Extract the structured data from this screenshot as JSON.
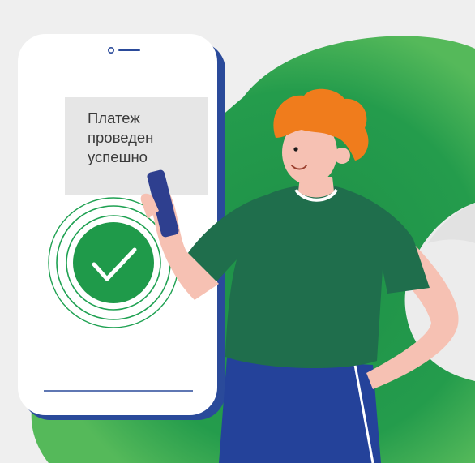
{
  "screen": {
    "message_lines": [
      "Платеж",
      "проведен",
      "успешно"
    ]
  },
  "colors": {
    "background": "#efefef",
    "brand_green": "#1f9a4a",
    "dark_green": "#1e6e4b",
    "phone_frame": "#2a4a9a",
    "hair": "#f07c1c",
    "skin": "#f6c1b3",
    "pants": "#24429a",
    "phone_device": "#2e3f8f"
  },
  "icons": [
    "checkmark-icon",
    "speaker-slot-icon"
  ]
}
